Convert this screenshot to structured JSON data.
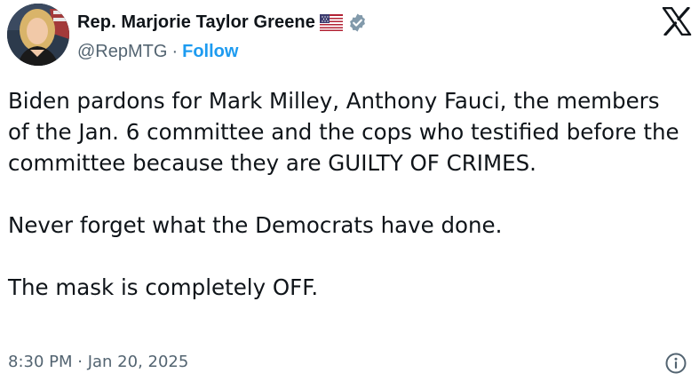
{
  "author": {
    "display_name": "Rep. Marjorie Taylor Greene",
    "handle": "@RepMTG",
    "separator": "·",
    "follow_label": "Follow",
    "badge_icon": "verified-badge-icon",
    "flag_icon": "us-flag-icon",
    "avatar_icon": "profile-photo"
  },
  "platform_logo": "x-logo-icon",
  "tweet": {
    "paragraph_1": "Biden pardons for Mark Milley, Anthony Fauci, the members of the Jan. 6 committee and the cops who testified before the committee because they are GUILTY OF CRIMES.",
    "paragraph_2": "Never forget what the Democrats have done.",
    "paragraph_3": "The mask is completely OFF."
  },
  "meta": {
    "timestamp": "8:30 PM · Jan 20, 2025",
    "info_icon": "info-icon"
  },
  "colors": {
    "text": "#0f1419",
    "secondary": "#536471",
    "link": "#1d9bf0",
    "badge": "#829aab"
  }
}
